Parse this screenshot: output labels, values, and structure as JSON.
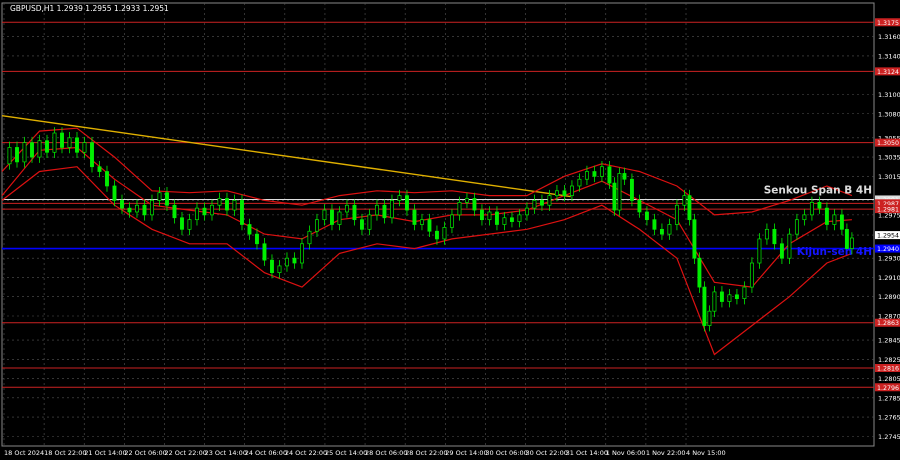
{
  "window": {
    "title": "GBPUSD,H1  1.2939 1.2955 1.2933 1.2951"
  },
  "chart_data": {
    "type": "line",
    "symbol": "GBPUSD",
    "timeframe": "H1",
    "ohlc": {
      "open": "1.2939",
      "high": "1.2955",
      "low": "1.2933",
      "close": "1.2951"
    },
    "ylim": [
      1.2735,
      1.3195
    ],
    "grid": true,
    "y_ticks": [
      "1.3160",
      "1.3140",
      "1.3100",
      "1.3080",
      "1.3055",
      "1.3035",
      "1.3015",
      "1.2990",
      "1.2975",
      "1.2954",
      "1.2930",
      "1.2910",
      "1.2890",
      "1.2870",
      "1.2845",
      "1.2825",
      "1.2805",
      "1.2785",
      "1.2765",
      "1.2745"
    ],
    "x_ticks": [
      "18 Oct 2024",
      "18 Oct 22:00",
      "21 Oct 14:00",
      "22 Oct 06:00",
      "22 Oct 22:00",
      "23 Oct 14:00",
      "24 Oct 06:00",
      "24 Oct 22:00",
      "25 Oct 14:00",
      "28 Oct 06:00",
      "28 Oct 22:00",
      "29 Oct 14:00",
      "30 Oct 06:00",
      "30 Oct 22:00",
      "31 Oct 14:00",
      "1 Nov 06:00",
      "1 Nov 22:00",
      "4 Nov 15:00"
    ],
    "horizontal_levels": [
      {
        "value": 1.3175,
        "label": "1.3175",
        "color": "#cc2222"
      },
      {
        "value": 1.3124,
        "label": "1.3124",
        "color": "#cc2222"
      },
      {
        "value": 1.305,
        "label": "1.3050",
        "color": "#cc2222"
      },
      {
        "value": 1.2991,
        "label": "1.2991",
        "color": "#dddddd"
      },
      {
        "value": 1.2987,
        "label": "1.2987",
        "color": "#cc2222"
      },
      {
        "value": 1.2981,
        "label": "1.2981",
        "color": "#cc2222"
      },
      {
        "value": 1.294,
        "label": "1.2940",
        "color": "#0000ff"
      },
      {
        "value": 1.2863,
        "label": "1.2863",
        "color": "#cc2222"
      },
      {
        "value": 1.2816,
        "label": "1.2816",
        "color": "#cc2222"
      },
      {
        "value": 1.2796,
        "label": "1.2796",
        "color": "#cc2222"
      }
    ],
    "level_annotations": [
      {
        "text": "Senkou Span B 4H",
        "value": 1.2994,
        "color": "#dcdcdc"
      },
      {
        "text": "Kijun-sen 4H",
        "value": 1.293,
        "color": "#1515ff"
      }
    ],
    "current_price": {
      "value": 1.2954,
      "label": "1.2954"
    },
    "trendline": {
      "from": [
        0,
        1.3078
      ],
      "to": [
        455,
        1.2994
      ],
      "color": "#e0b000"
    },
    "price_series": [
      [
        0,
        1.3028
      ],
      [
        6,
        1.3045
      ],
      [
        12,
        1.303
      ],
      [
        18,
        1.305
      ],
      [
        24,
        1.3035
      ],
      [
        30,
        1.3052
      ],
      [
        36,
        1.304
      ],
      [
        42,
        1.306
      ],
      [
        48,
        1.3045
      ],
      [
        54,
        1.3055
      ],
      [
        60,
        1.304
      ],
      [
        66,
        1.305
      ],
      [
        72,
        1.3025
      ],
      [
        78,
        1.302
      ],
      [
        84,
        1.3005
      ],
      [
        90,
        1.299
      ],
      [
        96,
        1.2982
      ],
      [
        102,
        1.2978
      ],
      [
        108,
        1.2985
      ],
      [
        114,
        1.2975
      ],
      [
        120,
        1.299
      ],
      [
        126,
        1.2998
      ],
      [
        132,
        1.2985
      ],
      [
        138,
        1.2972
      ],
      [
        144,
        1.296
      ],
      [
        150,
        1.297
      ],
      [
        156,
        1.2982
      ],
      [
        162,
        1.2975
      ],
      [
        168,
        1.2985
      ],
      [
        174,
        1.2992
      ],
      [
        180,
        1.298
      ],
      [
        186,
        1.299
      ],
      [
        192,
        1.2965
      ],
      [
        198,
        1.2955
      ],
      [
        204,
        1.2945
      ],
      [
        210,
        1.2928
      ],
      [
        216,
        1.2915
      ],
      [
        222,
        1.2922
      ],
      [
        228,
        1.293
      ],
      [
        234,
        1.2925
      ],
      [
        240,
        1.2945
      ],
      [
        246,
        1.2958
      ],
      [
        252,
        1.297
      ],
      [
        258,
        1.298
      ],
      [
        264,
        1.2965
      ],
      [
        270,
        1.2978
      ],
      [
        276,
        1.2985
      ],
      [
        282,
        1.297
      ],
      [
        288,
        1.296
      ],
      [
        294,
        1.2975
      ],
      [
        300,
        1.2985
      ],
      [
        306,
        1.2972
      ],
      [
        312,
        1.299
      ],
      [
        318,
        1.2995
      ],
      [
        324,
        1.298
      ],
      [
        330,
        1.2965
      ],
      [
        336,
        1.297
      ],
      [
        342,
        1.2958
      ],
      [
        348,
        1.295
      ],
      [
        354,
        1.2962
      ],
      [
        360,
        1.2975
      ],
      [
        366,
        1.2988
      ],
      [
        372,
        1.2992
      ],
      [
        378,
        1.298
      ],
      [
        384,
        1.297
      ],
      [
        390,
        1.2978
      ],
      [
        396,
        1.2965
      ],
      [
        402,
        1.2972
      ],
      [
        408,
        1.2968
      ],
      [
        414,
        1.2975
      ],
      [
        420,
        1.2982
      ],
      [
        426,
        1.299
      ],
      [
        432,
        1.2985
      ],
      [
        438,
        1.2995
      ],
      [
        444,
        1.3
      ],
      [
        450,
        1.2995
      ],
      [
        456,
        1.3005
      ],
      [
        462,
        1.3012
      ],
      [
        468,
        1.302
      ],
      [
        474,
        1.3015
      ],
      [
        480,
        1.3025
      ],
      [
        486,
        1.3008
      ],
      [
        490,
        1.298
      ],
      [
        494,
        1.3018
      ],
      [
        498,
        1.3012
      ],
      [
        504,
        1.299
      ],
      [
        510,
        1.2978
      ],
      [
        516,
        1.297
      ],
      [
        522,
        1.296
      ],
      [
        528,
        1.2955
      ],
      [
        534,
        1.2965
      ],
      [
        540,
        1.2985
      ],
      [
        546,
        1.2995
      ],
      [
        550,
        1.297
      ],
      [
        554,
        1.293
      ],
      [
        558,
        1.29
      ],
      [
        562,
        1.286
      ],
      [
        566,
        1.2875
      ],
      [
        570,
        1.2895
      ],
      [
        576,
        1.2885
      ],
      [
        582,
        1.2892
      ],
      [
        588,
        1.2888
      ],
      [
        594,
        1.29
      ],
      [
        600,
        1.2925
      ],
      [
        606,
        1.295
      ],
      [
        612,
        1.296
      ],
      [
        618,
        1.2945
      ],
      [
        624,
        1.293
      ],
      [
        630,
        1.2955
      ],
      [
        636,
        1.297
      ],
      [
        642,
        1.2975
      ],
      [
        648,
        1.2988
      ],
      [
        654,
        1.2982
      ],
      [
        660,
        1.2965
      ],
      [
        666,
        1.2975
      ],
      [
        672,
        1.296
      ],
      [
        676,
        1.294
      ],
      [
        680,
        1.2951
      ]
    ],
    "bands": {
      "upper": [
        [
          0,
          1.302
        ],
        [
          30,
          1.3062
        ],
        [
          60,
          1.3065
        ],
        [
          90,
          1.3035
        ],
        [
          120,
          1.3
        ],
        [
          150,
          1.2998
        ],
        [
          180,
          1.3
        ],
        [
          210,
          1.299
        ],
        [
          240,
          1.2985
        ],
        [
          270,
          1.2995
        ],
        [
          300,
          1.3
        ],
        [
          330,
          1.2998
        ],
        [
          360,
          1.3
        ],
        [
          390,
          1.2995
        ],
        [
          420,
          1.2995
        ],
        [
          450,
          1.3015
        ],
        [
          480,
          1.3028
        ],
        [
          510,
          1.302
        ],
        [
          540,
          1.3005
        ],
        [
          570,
          1.2975
        ],
        [
          600,
          1.2978
        ],
        [
          630,
          1.299
        ],
        [
          660,
          1.3005
        ],
        [
          680,
          1.2995
        ]
      ],
      "middle": [
        [
          0,
          1.2995
        ],
        [
          30,
          1.3042
        ],
        [
          60,
          1.3045
        ],
        [
          90,
          1.3012
        ],
        [
          120,
          1.2985
        ],
        [
          150,
          1.298
        ],
        [
          180,
          1.2975
        ],
        [
          210,
          1.2955
        ],
        [
          240,
          1.295
        ],
        [
          270,
          1.297
        ],
        [
          300,
          1.2975
        ],
        [
          330,
          1.2968
        ],
        [
          360,
          1.2975
        ],
        [
          390,
          1.2975
        ],
        [
          420,
          1.298
        ],
        [
          450,
          1.2995
        ],
        [
          480,
          1.301
        ],
        [
          510,
          1.299
        ],
        [
          540,
          1.297
        ],
        [
          570,
          1.2905
        ],
        [
          600,
          1.29
        ],
        [
          630,
          1.2945
        ],
        [
          660,
          1.2968
        ],
        [
          680,
          1.297
        ]
      ],
      "lower": [
        [
          0,
          1.299
        ],
        [
          30,
          1.302
        ],
        [
          60,
          1.3025
        ],
        [
          90,
          1.2985
        ],
        [
          120,
          1.296
        ],
        [
          150,
          1.2945
        ],
        [
          180,
          1.2945
        ],
        [
          210,
          1.2915
        ],
        [
          240,
          1.29
        ],
        [
          270,
          1.2935
        ],
        [
          300,
          1.2945
        ],
        [
          330,
          1.294
        ],
        [
          360,
          1.295
        ],
        [
          390,
          1.2955
        ],
        [
          420,
          1.296
        ],
        [
          450,
          1.297
        ],
        [
          480,
          1.2985
        ],
        [
          510,
          1.296
        ],
        [
          540,
          1.293
        ],
        [
          570,
          1.283
        ],
        [
          600,
          1.286
        ],
        [
          630,
          1.289
        ],
        [
          660,
          1.2925
        ],
        [
          680,
          1.2935
        ]
      ]
    },
    "colors": {
      "background": "#000000",
      "grid": "#555555",
      "candles": "#00ee00",
      "bands": "#dd1111",
      "trendline": "#e0b000",
      "text": "#ffffff"
    }
  }
}
